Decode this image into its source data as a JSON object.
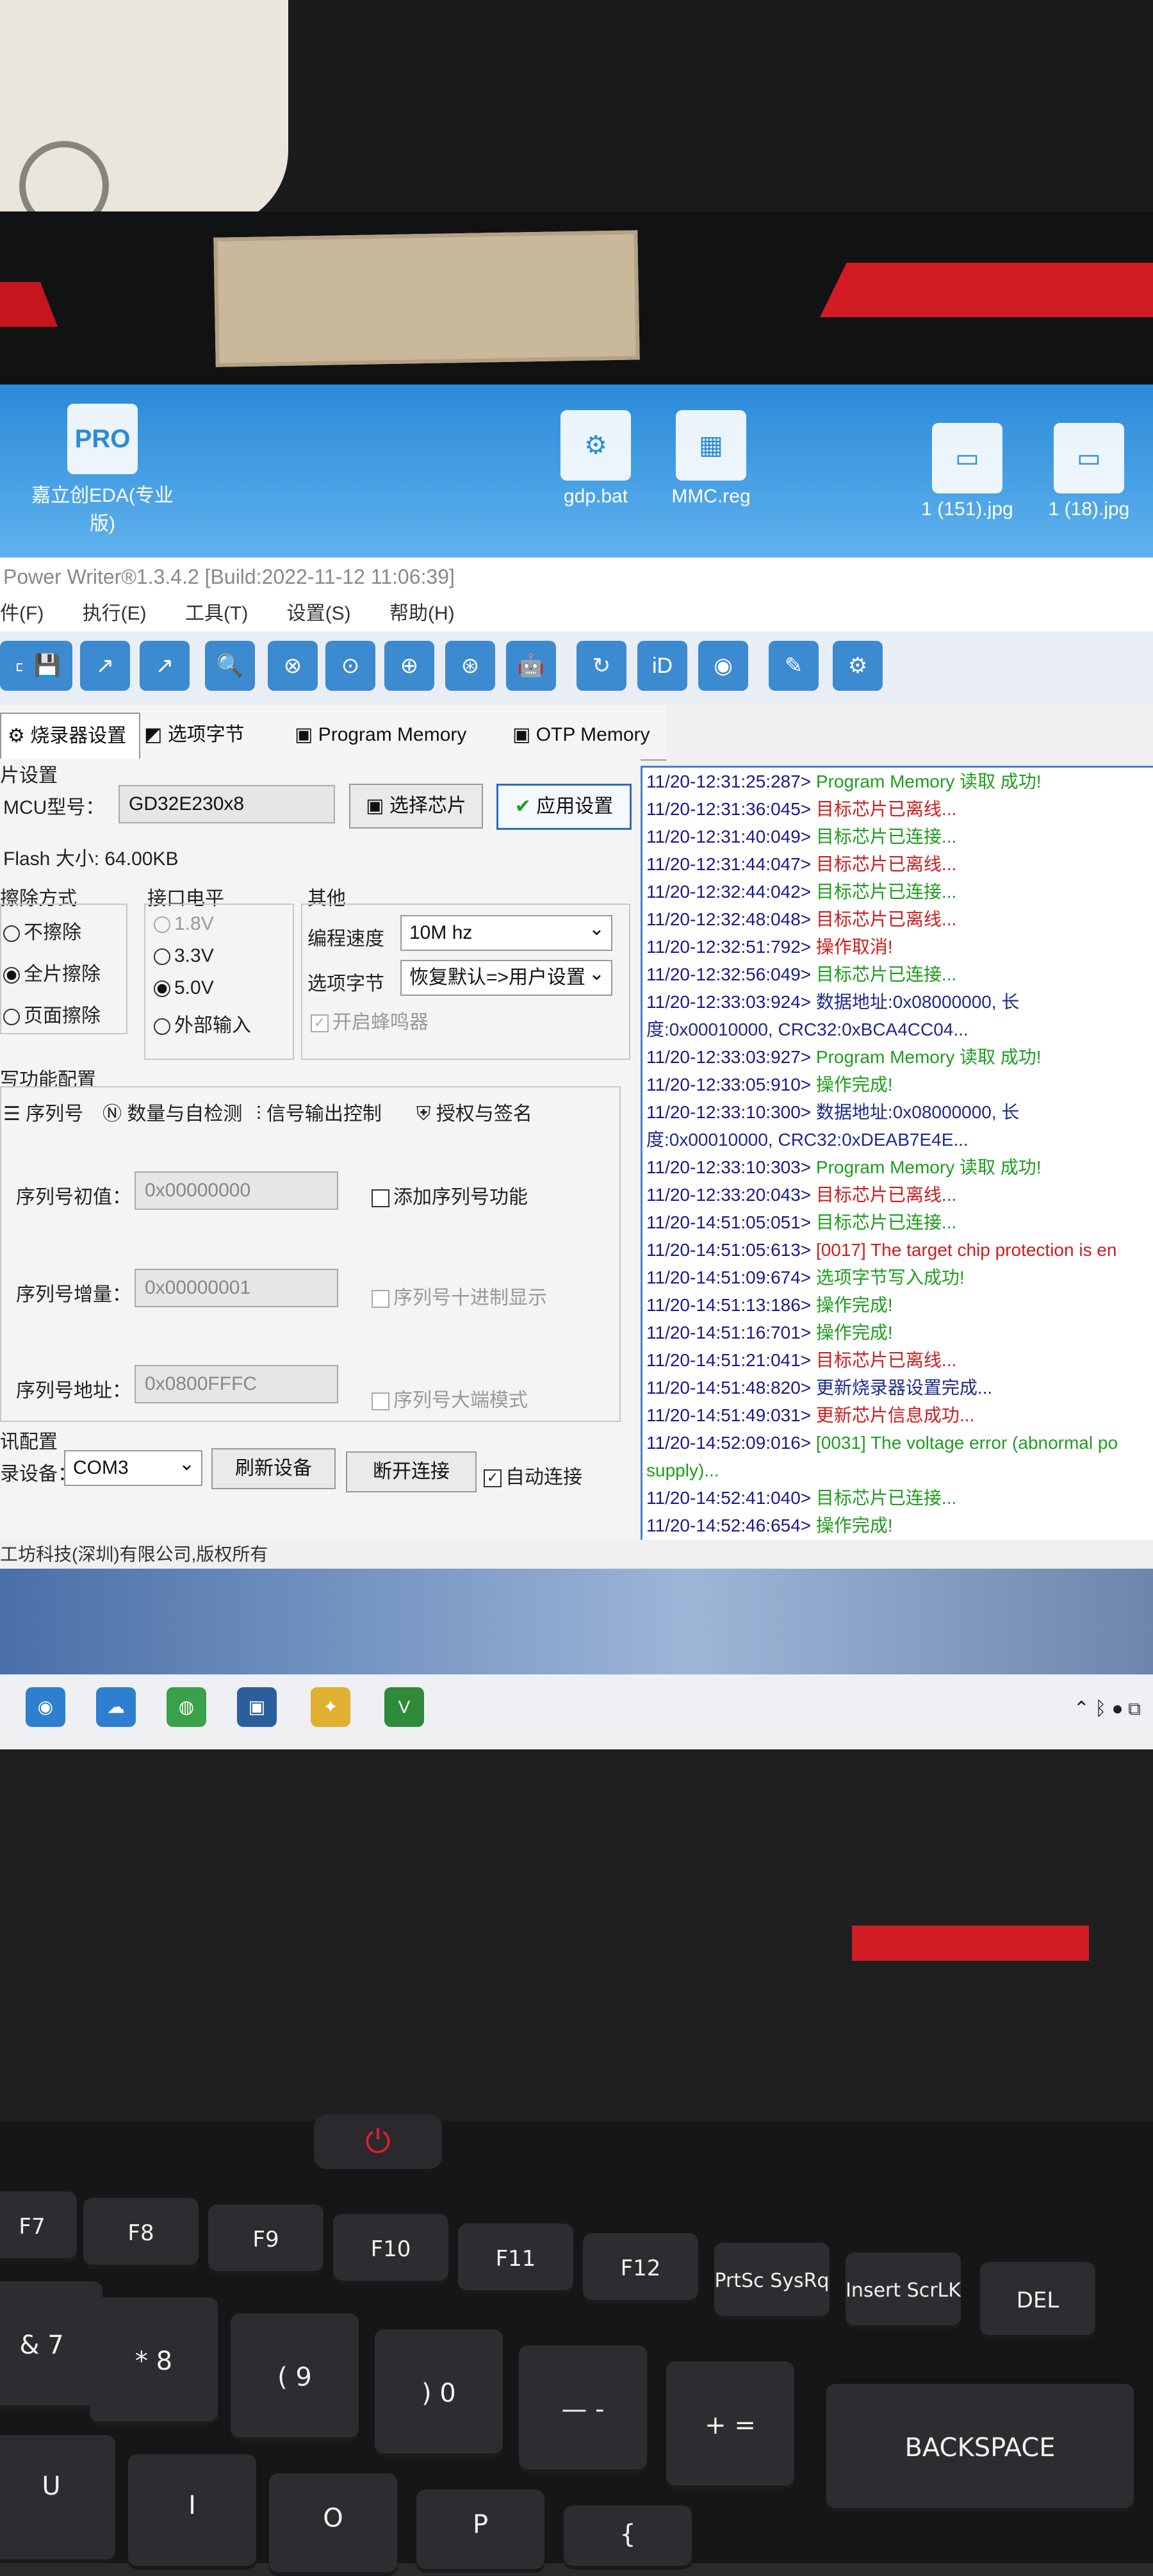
{
  "desktop": {
    "icons": [
      {
        "label": "嘉立创EDA(专业版)",
        "glyph": "PRO"
      },
      {
        "label": "gdp.bat",
        "glyph": "⚙"
      },
      {
        "label": "MMC.reg",
        "glyph": "▦"
      },
      {
        "label": "1 (151).jpg",
        "glyph": "▭"
      },
      {
        "label": "1 (18).jpg",
        "glyph": "▭"
      }
    ]
  },
  "window": {
    "title": "Power Writer®1.3.4.2 [Build:2022-11-12 11:06:39]"
  },
  "menu": [
    "件(F)",
    "执行(E)",
    "工具(T)",
    "设置(S)",
    "帮助(H)"
  ],
  "toolbar": {
    "icons": [
      "save-icon",
      "save-icon",
      "export-icon",
      "share-icon",
      "search-icon",
      "erase-icon",
      "read-icon",
      "write-icon",
      "verify-icon",
      "robot-icon",
      "refresh-icon",
      "id-icon",
      "stop-icon",
      "brush-icon",
      "config-icon"
    ],
    "glyphs": [
      "▭",
      "💾",
      "↗",
      "↗",
      "🔍",
      "⊗",
      "⊙",
      "⊕",
      "⊛",
      "🤖",
      "↻",
      "iD",
      "◉",
      "✎",
      "⚙"
    ]
  },
  "tabs": [
    "烧录器设置",
    "选项字节",
    "Program Memory",
    "OTP Memory"
  ],
  "chip": {
    "section": "片设置",
    "mcu_label": "MCU型号：",
    "mcu_value": "GD32E230x8",
    "select_chip": "选择芯片",
    "apply": "应用设置",
    "flash": "Flash 大小: 64.00KB"
  },
  "erase": {
    "title": "擦除方式",
    "options": [
      "不擦除",
      "全片擦除",
      "页面擦除"
    ],
    "selected": 1
  },
  "voltage": {
    "title": "接口电平",
    "options": [
      "1.8V",
      "3.3V",
      "5.0V",
      "外部输入"
    ],
    "selected": 2
  },
  "other": {
    "title": "其他",
    "speed_label": "编程速度",
    "speed_value": "10M hz",
    "option_label": "选项字节",
    "option_value": "恢复默认=>用户设置",
    "buzzer": "开启蜂鸣器"
  },
  "extra": {
    "section": "写功能配置",
    "tabs": [
      "序列号",
      "数量与自检测",
      "信号输出控制",
      "授权与签名"
    ]
  },
  "serial": {
    "init_label": "序列号初值：",
    "init_value": "0x00000000",
    "inc_label": "序列号增量：",
    "inc_value": "0x00000001",
    "addr_label": "序列号地址：",
    "addr_value": "0x0800FFFC",
    "add_fn": "添加序列号功能",
    "decimal": "序列号十进制显示",
    "bigendian": "序列号大端模式"
  },
  "comm": {
    "section": "讯配置",
    "device_label": "录设备：",
    "device_value": "COM3",
    "refresh": "刷新设备",
    "disconnect": "断开连接",
    "auto": "自动连接"
  },
  "footer": "工坊科技(深圳)有限公司,版权所有",
  "log": [
    {
      "ts": "11/20-12:31:25:287>",
      "msg": " Program Memory 读取 成功!",
      "color": "green"
    },
    {
      "ts": "11/20-12:31:36:045>",
      "msg": " 目标芯片已离线...",
      "color": "red"
    },
    {
      "ts": "11/20-12:31:40:049>",
      "msg": " 目标芯片已连接...",
      "color": "green"
    },
    {
      "ts": "11/20-12:31:44:047>",
      "msg": " 目标芯片已离线...",
      "color": "red"
    },
    {
      "ts": "11/20-12:32:44:042>",
      "msg": " 目标芯片已连接...",
      "color": "green"
    },
    {
      "ts": "11/20-12:32:48:048>",
      "msg": " 目标芯片已离线...",
      "color": "red"
    },
    {
      "ts": "11/20-12:32:51:792>",
      "msg": " 操作取消!",
      "color": "red"
    },
    {
      "ts": "11/20-12:32:56:049>",
      "msg": " 目标芯片已连接...",
      "color": "green"
    },
    {
      "ts": "11/20-12:33:03:924>",
      "msg": " 数据地址:0x08000000, 长",
      "color": "blue"
    },
    {
      "ts": "",
      "msg": "度:0x00010000, CRC32:0xBCA4CC04...",
      "color": "blue"
    },
    {
      "ts": "11/20-12:33:03:927>",
      "msg": " Program Memory 读取 成功!",
      "color": "green"
    },
    {
      "ts": "11/20-12:33:05:910>",
      "msg": " 操作完成!",
      "color": "green"
    },
    {
      "ts": "11/20-12:33:10:300>",
      "msg": " 数据地址:0x08000000, 长",
      "color": "blue"
    },
    {
      "ts": "",
      "msg": "度:0x00010000, CRC32:0xDEAB7E4E...",
      "color": "blue"
    },
    {
      "ts": "11/20-12:33:10:303>",
      "msg": " Program Memory 读取 成功!",
      "color": "green"
    },
    {
      "ts": "11/20-12:33:20:043>",
      "msg": " 目标芯片已离线...",
      "color": "red"
    },
    {
      "ts": "11/20-14:51:05:051>",
      "msg": " 目标芯片已连接...",
      "color": "green"
    },
    {
      "ts": "11/20-14:51:05:613>",
      "msg": " [0017] The target chip protection is en",
      "color": "red"
    },
    {
      "ts": "11/20-14:51:09:674>",
      "msg": " 选项字节写入成功!",
      "color": "green"
    },
    {
      "ts": "11/20-14:51:13:186>",
      "msg": " 操作完成!",
      "color": "green"
    },
    {
      "ts": "11/20-14:51:16:701>",
      "msg": " 操作完成!",
      "color": "green"
    },
    {
      "ts": "11/20-14:51:21:041>",
      "msg": " 目标芯片已离线...",
      "color": "red"
    },
    {
      "ts": "11/20-14:51:48:820>",
      "msg": " 更新烧录器设置完成...",
      "color": "blue"
    },
    {
      "ts": "11/20-14:51:49:031>",
      "msg": " 更新芯片信息成功...",
      "color": "red"
    },
    {
      "ts": "11/20-14:52:09:016>",
      "msg": " [0031] The voltage error (abnormal po",
      "color": "green"
    },
    {
      "ts": "",
      "msg": "supply)...",
      "color": "green"
    },
    {
      "ts": "11/20-14:52:41:040>",
      "msg": " 目标芯片已连接...",
      "color": "green"
    },
    {
      "ts": "11/20-14:52:46:654>",
      "msg": " 操作完成!",
      "color": "green"
    },
    {
      "ts": "11/20-14:52:53:038>",
      "msg": " 目标芯片已离线...",
      "color": "red"
    }
  ],
  "taskbar": {
    "apps": [
      "camera-icon",
      "cloud-icon",
      "browser-icon",
      "chip-icon",
      "python-icon",
      "vim-icon"
    ],
    "glyphs": [
      "◉",
      "☁",
      "◍",
      "▣",
      "✦",
      "V"
    ]
  },
  "keyboard": {
    "fkeys": [
      "F7",
      "F8",
      "F9",
      "F10",
      "F11",
      "F12",
      "PrtSc SysRq",
      "Insert ScrLK",
      "DEL"
    ],
    "numkeys": [
      "&\n7",
      "*\n8",
      "(\n9",
      ")\n0",
      "—\n-",
      "+\n=",
      "BACKSPACE"
    ],
    "bottom": [
      "U",
      "I",
      "O",
      "P",
      "{"
    ]
  },
  "colors": {
    "log_border": "#4a7fc7",
    "toolbar_button": "#3c8ad0",
    "ok_green": "#1e9d1e",
    "error_red": "#d01c1c",
    "laptop_red": "#d21b22"
  }
}
